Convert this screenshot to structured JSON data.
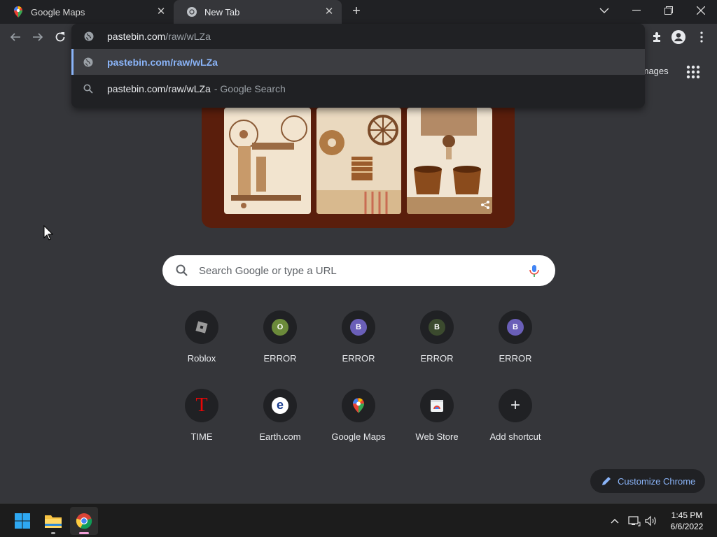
{
  "tabs": [
    {
      "title": "Google Maps",
      "active": false,
      "icon": "google-maps-icon"
    },
    {
      "title": "New Tab",
      "active": true,
      "icon": "chrome-icon"
    }
  ],
  "omnibox": {
    "typed_text": "pastebin.com",
    "autocomplete_text": "/raw/wLZa",
    "suggestions": [
      {
        "text": "pastebin.com/raw/wLZa",
        "type": "url",
        "icon": "globe-icon"
      },
      {
        "text": "pastebin.com/raw/wLZa",
        "desc": "- Google Search",
        "type": "search",
        "icon": "search-icon"
      }
    ]
  },
  "ntp": {
    "images_link": "Images",
    "search_placeholder": "Search Google or type a URL",
    "shortcuts": [
      {
        "label": "Roblox",
        "letter": "",
        "color": "#606060"
      },
      {
        "label": "ERROR",
        "letter": "O",
        "color": "#6b8a3a"
      },
      {
        "label": "ERROR",
        "letter": "B",
        "color": "#6a5fb8"
      },
      {
        "label": "ERROR",
        "letter": "B",
        "color": "#3b4a2e"
      },
      {
        "label": "ERROR",
        "letter": "B",
        "color": "#6a5fb8"
      },
      {
        "label": "TIME",
        "letter": "T",
        "color": "#e90606"
      },
      {
        "label": "Earth.com",
        "letter": "e",
        "color": "#1a3d8f"
      },
      {
        "label": "Google Maps",
        "letter": "",
        "color": "#34a853"
      },
      {
        "label": "Web Store",
        "letter": "",
        "color": "#f1f3f4"
      },
      {
        "label": "Add shortcut",
        "letter": "+",
        "color": "#e8eaed"
      }
    ],
    "customize_label": "Customize Chrome"
  },
  "taskbar": {
    "time": "1:45 PM",
    "date": "6/6/2022"
  },
  "colors": {
    "accent": "#8ab4f8",
    "frame": "#202124",
    "ntp_bg": "#35363a"
  }
}
